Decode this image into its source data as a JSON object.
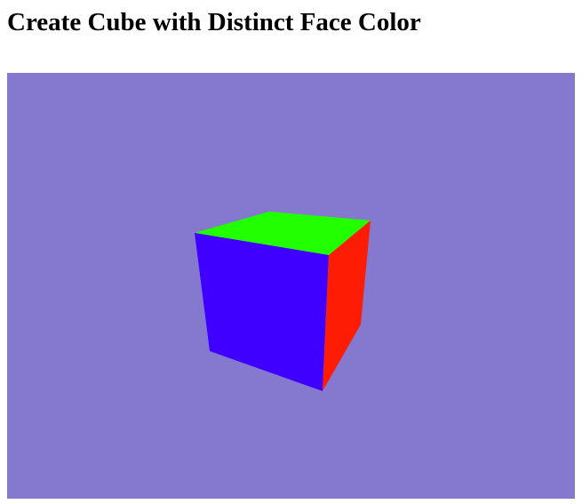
{
  "page": {
    "title": "Create Cube with Distinct Face Color"
  },
  "scene": {
    "background_color": "#8579CF",
    "object": "cube",
    "faces": [
      {
        "name": "top",
        "color": "#22FF00"
      },
      {
        "name": "front",
        "color": "#3F00FF"
      },
      {
        "name": "right",
        "color": "#FF1C04"
      }
    ]
  }
}
